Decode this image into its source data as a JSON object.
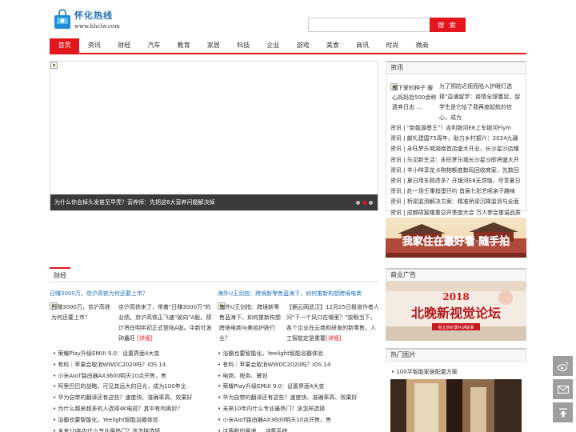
{
  "header": {
    "logo_title": "怀化热线",
    "logo_url": "www.hhclw.com",
    "search_placeholder": "",
    "search_button": "搜 索"
  },
  "nav": [
    "首页",
    "资讯",
    "财经",
    "汽车",
    "教育",
    "家居",
    "科技",
    "企业",
    "游戏",
    "美食",
    "商讯",
    "时尚",
    "微商"
  ],
  "slider": {
    "caption": "为什么你会掉头发甚至早秃？营养师：先把这6大营养问题解决掉",
    "dots": 3,
    "active_dot": 1
  },
  "news": {
    "heading": "资讯",
    "thumb_alt": "播下爱的种子 暖心妈妈捡500余种遗弃日志 ...",
    "thumb_desc": "为了预防近视而陷入护眼灯选择\"益诵留学：疫情全球蔓延，留学生是它给了我再度起航的信心，成为",
    "items": [
      "资讯 | \"新能源巻王\"！吉利银河E8上车银河Flym",
      "资讯 | 献礼建国75周年，助力乡村振兴：2024九疆",
      "资讯 | 永旺梦乐城湖南首店盛大开业，长沙星沙店耀",
      "资讯 | 乐见新生活：永旺梦乐城长沙星沙即将盛大开",
      "资讯 | 羊小咩享花卡购物额度数码回收商家，先数回",
      "资讯 | 夏日用车顾虑多？开银河E8无烦恼，尽享夏日",
      "资讯 | 赴一场壬秉指蛋仔约 首届七彩艺呢亲子趣味",
      "资讯 | 桥梁监测解决方案：精准桥梁沉降监测与全面",
      "资讯 | 成都硕宸隆重召开季度大会 万人参会重温品质"
    ]
  },
  "banner1_text": "我家住在最好看·随手拍",
  "ad": {
    "heading": "商业广告",
    "year": "2018",
    "text": "北晚新视觉论坛",
    "sub": "看北京纪录片讲故事"
  },
  "finance": {
    "heading": "财经",
    "left": {
      "title": "日赚3000万，京沪高铁为何还要上市？",
      "img_alt": "日赚3000万，京沪高铁为何还要上市？",
      "desc": "京沪高铁来了，带着\"日赚3000万\"的业绩。京沪高铁正飞速\"驶向\"A股。预计将在明年初正式登陆A股。中新社发 钟鑫旺 ",
      "more": "[详细]"
    },
    "right": {
      "title": "海外U王剑指：跨境新零售蓝海下，如何重新构想跨境电商",
      "img_alt": "海外U王剑指：跨境新零售蓝海下，如何重新构想跨境电商与美妆护肤行业？",
      "desc": "【据云网武汉】12月25日报道作者人问\"下一个风口在哪里？\"放眼当下，各个企业在云商和研发的新零售。人工智能定是重要",
      "more": "[详细]"
    },
    "left_list": [
      "荣耀Play升级EMUI 9.0：设置界面4大变",
      "有料｜苹果会取消WWDC2020吗？iOS 14",
      "小米AIoT路由器AX3600明天10点开售，售",
      "阿里巴巴的战略，可见其远大的目光，成为100年企",
      "华为自带的翻译还有这些？速度快、准确率高、效果好",
      "为什么越来越多的人选择4K电视？其中有何奥妙？",
      "浴霸也要智能化，Yeelight智能浴霸体验",
      "未来10年内什么专业最热门？该怎样选择"
    ],
    "right_list": [
      "浴霸也要智能化，Yeelight智能浴霸体验",
      "有料｜苹果会取消WWDC2020吗？iOS 14",
      "电商、税务、幂划",
      "荣耀Play升级EMUI 9.0：设置界面4大变",
      "华为自带的翻译还有这些？速度快、准确率高、效果好",
      "未来10年内什么专业最热门？该怎样选择",
      "小米AIoT路由器AX3600明天10点开售，售",
      "这两款的最速 ... 诗集系统"
    ]
  },
  "hot": {
    "heading": "热门图片",
    "title": "• 100平智能家居配置方案"
  },
  "float": {
    "weibo_icon": "weibo-icon",
    "mail_icon": "mail-icon",
    "top_icon": "back-to-top-icon"
  }
}
